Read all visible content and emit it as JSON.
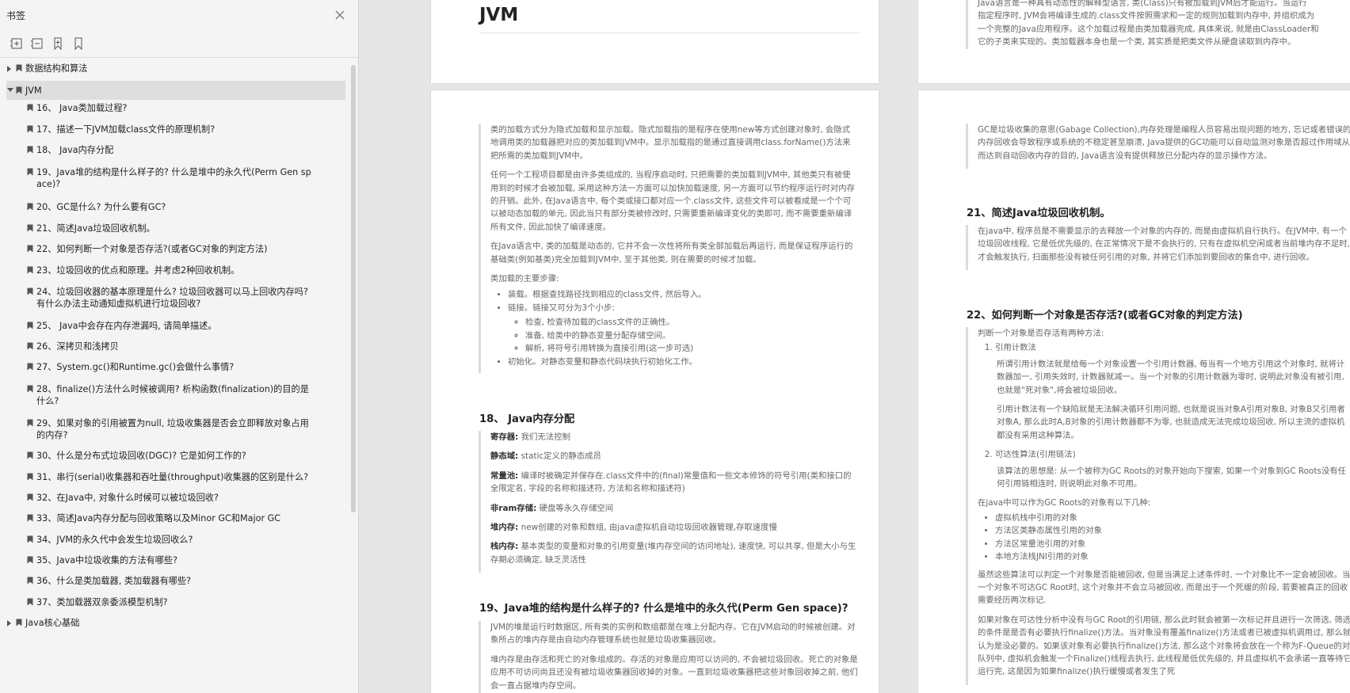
{
  "sidebar": {
    "title": "书签",
    "items": [
      {
        "label": "数据结构和算法",
        "level": 0,
        "expanded": false
      },
      {
        "label": "JVM",
        "level": 0,
        "expanded": true,
        "selected": true
      },
      {
        "label": "16、 Java类加载过程?",
        "level": 1
      },
      {
        "label": "17、描述一下JVM加载class文件的原理机制?",
        "level": 1
      },
      {
        "label": "18、 Java内存分配",
        "level": 1
      },
      {
        "label": "19、Java堆的结构是什么样子的? 什么是堆中的永久代(Perm Gen space)?",
        "level": 1
      },
      {
        "label": "20、GC是什么? 为什么要有GC?",
        "level": 1
      },
      {
        "label": "21、简述Java垃圾回收机制。",
        "level": 1
      },
      {
        "label": "22、如何判断一个对象是否存活?(或者GC对象的判定方法)",
        "level": 1
      },
      {
        "label": "23、垃圾回收的优点和原理。并考虑2种回收机制。",
        "level": 1
      },
      {
        "label": "24、垃圾回收器的基本原理是什么? 垃圾回收器可以马上回收内存吗? 有什么办法主动通知虚拟机进行垃圾回收?",
        "level": 1
      },
      {
        "label": "25、 Java中会存在内存泄漏吗, 请简单描述。",
        "level": 1
      },
      {
        "label": "26、深拷贝和浅拷贝",
        "level": 1
      },
      {
        "label": "27、System.gc()和Runtime.gc()会做什么事情?",
        "level": 1
      },
      {
        "label": "28、finalize()方法什么时候被调用? 析构函数(finalization)的目的是什么?",
        "level": 1
      },
      {
        "label": "29、如果对象的引用被置为null, 垃圾收集器是否会立即释放对象占用的内存?",
        "level": 1
      },
      {
        "label": "30、什么是分布式垃圾回收(DGC)? 它是如何工作的?",
        "level": 1
      },
      {
        "label": "31、串行(serial)收集器和吞吐量(throughput)收集器的区别是什么?",
        "level": 1
      },
      {
        "label": "32、在Java中, 对象什么时候可以被垃圾回收?",
        "level": 1
      },
      {
        "label": "33、简述Java内存分配与回收策略以及Minor GC和Major GC",
        "level": 1
      },
      {
        "label": "34、JVM的永久代中会发生垃圾回收么?",
        "level": 1
      },
      {
        "label": "35、Java中垃圾收集的方法有哪些?",
        "level": 1
      },
      {
        "label": "36、什么是类加载器, 类加载器有哪些?",
        "level": 1
      },
      {
        "label": "37、类加载器双亲委派模型机制?",
        "level": 1
      },
      {
        "label": "Java核心基础",
        "level": 0,
        "expanded": false
      }
    ]
  },
  "doc": {
    "page1_title": "JVM",
    "top_right": [
      "Java语言是一种具有动态性的解释型语言, 类(Class)只有被加载到JVM后才能运行。当运行",
      "指定程序时, JVM会将编译生成的.class文件按照需求和一定的规则加载到内存中, 并组织成为",
      "一个完整的Java应用程序。这个加载过程是由类加载器完成, 具体来说, 就是由ClassLoader和",
      "它的子类来实现的。类加载器本身也是一个类, 其实质是把类文件从硬盘读取到内存中。"
    ],
    "left_col": {
      "p1": "类的加载方式分为隐式加载和显示加载。隐式加载指的是程序在使用new等方式创建对象时, 会隐式地调用类的加载器把对应的类加载到JVM中。显示加载指的是通过直接调用class.forName()方法来把所需的类加载到JVM中。",
      "p2": "任何一个工程项目都是由许多类组成的, 当程序启动时, 只把需要的类加载到JVM中, 其他类只有被使用到的时候才会被加载, 采用这种方法一方面可以加快加载速度, 另一方面可以节约程序运行时对内存的开销。此外, 在Java语言中, 每个类或接口都对应一个.class文件, 这些文件可以被看成是一个个可以被动态加载的单元, 因此当只有部分类被修改时, 只需要重新编译变化的类即可, 而不需要重新编译所有文件, 因此加快了编译速度。",
      "p3": "在Java语言中, 类的加载是动态的, 它并不会一次性将所有类全部加载后再运行, 而是保证程序运行的基础类(例如基类)完全加载到JVM中, 至于其他类, 则在需要的时候才加载。",
      "p4": "类加载的主要步骤:",
      "steps": [
        "装载。根据查找路径找到相应的class文件, 然后导入。",
        "链接。链接又可分为3个小步:"
      ],
      "substeps": [
        "检查, 检查待加载的class文件的正确性。",
        "准备, 给类中的静态变量分配存储空间。",
        "解析, 将符号引用转换为直接引用(这一步可选)"
      ],
      "step3": "初始化。对静态变量和静态代码块执行初始化工作。",
      "h18": "18、 Java内存分配",
      "mem": [
        {
          "k": "寄存器:",
          "v": "我们无法控制"
        },
        {
          "k": "静态域:",
          "v": "static定义的静态成员"
        },
        {
          "k": "常量池:",
          "v": "编译时被确定并保存在.class文件中的(final)常量值和一些文本修饰的符号引用(类和接口的全限定名, 字段的名称和描述符, 方法和名称和描述符)"
        },
        {
          "k": "非ram存储:",
          "v": "硬盘等永久存储空间"
        },
        {
          "k": "堆内存:",
          "v": "new创建的对象和数组, 由java虚拟机自动垃圾回收器管理,存取速度慢"
        },
        {
          "k": "栈内存:",
          "v": "基本类型的变量和对象的引用变量(堆内存空间的访问地址), 速度快, 可以共享, 但是大小与生存期必须确定, 缺乏灵活性"
        }
      ],
      "h19": "19、Java堆的结构是什么样子的? 什么是堆中的永久代(Perm Gen space)?",
      "p19a": "JVM的堆是运行时数据区, 所有类的实例和数组都是在堆上分配内存。它在JVM启动的时候被创建。对象所占的堆内存是由自动内存管理系统也就是垃圾收集器回收。",
      "p19b": "堆内存是由存活和死亡的对象组成的。存活的对象是应用可以访问的, 不会被垃圾回收。死亡的对象是应用不可访问尚且还没有被垃圾收集器回收掉的对象。一直到垃圾收集器把这些对象回收掉之前, 他们会一直占据堆内存空间。"
    },
    "right_col": {
      "p20": "GC是垃圾收集的意思(Gabage Collection),内存处理是编程人员容易出现问题的地方, 忘记或者错误的内存回收会导致程序或系统的不稳定甚至崩溃, Java提供的GC功能可以自动监测对象是否超过作用域从而达到自动回收内存的目的, Java语言没有提供释放已分配内存的显示操作方法。",
      "h21": "21、简述Java垃圾回收机制。",
      "p21": "在java中, 程序员是不需要显示的去释放一个对象的内存的, 而是由虚拟机自行执行。在JVM中, 有一个垃圾回收线程, 它是低优先级的, 在正常情况下是不会执行的, 只有在虚拟机空闲或者当前堆内存不足时, 才会触发执行, 扫面那些没有被任何引用的对象, 并将它们添加到要回收的集合中, 进行回收。",
      "h22": "22、如何判断一个对象是否存活?(或者GC对象的判定方法)",
      "p22": "判断一个对象是否存活有两种方法:",
      "m1": "引用计数法",
      "m1a": "所谓引用计数法就是给每一个对象设置一个引用计数器, 每当有一个地方引用这个对象时, 就将计数器加一, 引用失效时, 计数器就减一。当一个对象的引用计数器为零时, 说明此对象没有被引用, 也就是\"死对象\",将会被垃圾回收。",
      "m1b": "引用计数法有一个缺陷就是无法解决循环引用问题, 也就是说当对象A引用对象B, 对象B又引用者对象A, 那么此时A,B对象的引用计数器都不为零, 也就造成无法完成垃圾回收, 所以主流的虚拟机都没有采用这种算法。",
      "m2": "可达性算法(引用链法)",
      "m2a": "该算法的思想是: 从一个被称为GC Roots的对象开始向下搜索, 如果一个对象到GC Roots没有任何引用链相连时, 则说明此对象不可用。",
      "roots_title": "在java中可以作为GC Roots的对象有以下几种:",
      "roots": [
        "虚拟机栈中引用的对象",
        "方法区类静态属性引用的对象",
        "方法区常量池引用的对象",
        "本地方法栈JNI引用的对象"
      ],
      "p22b": "虽然这些算法可以判定一个对象是否能被回收, 但是当满足上述条件时, 一个对象比不一定会被回收。当一个对象不可达GC Root时, 这个对象并不会立马被回收, 而是出于一个死缓的阶段, 若要被真正的回收需要经历两次标记.",
      "p22c": "如果对象在可达性分析中没有与GC Root的引用链, 那么此时就会被第一次标记并且进行一次筛选, 筛选的条件是是否有必要执行finalize()方法。当对象没有覆盖finalize()方法或者已被虚拟机调用过, 那么就认为是没必要的。如果该对象有必要执行finalize()方法, 那么这个对象将会放在一个称为F-Queue的对队列中, 虚拟机会触发一个Finalize()线程去执行, 此线程是低优先级的, 并且虚拟机不会承诺一直等待它运行完, 这是因为如果finalize()执行缓慢或者发生了死"
    }
  }
}
